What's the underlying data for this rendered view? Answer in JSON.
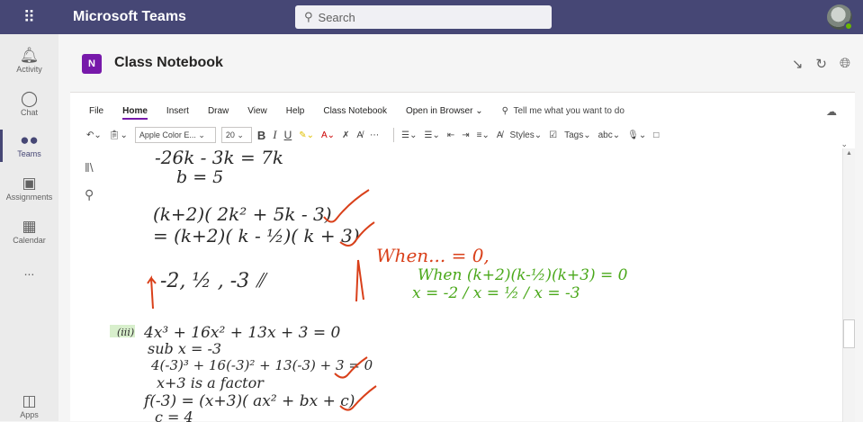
{
  "topbar": {
    "waffle_icon": "app-launcher-icon",
    "app_name": "Microsoft Teams",
    "search_placeholder": "Search",
    "search_icon": "search-icon"
  },
  "rail": {
    "items": [
      {
        "label": "Activity",
        "icon": "bell-icon"
      },
      {
        "label": "Chat",
        "icon": "chat-icon"
      },
      {
        "label": "Teams",
        "icon": "teams-icon",
        "active": true
      },
      {
        "label": "Assignments",
        "icon": "assignments-icon"
      },
      {
        "label": "Calendar",
        "icon": "calendar-icon"
      },
      {
        "label": "...",
        "icon": "more-icon"
      },
      {
        "label": "Apps",
        "icon": "apps-icon"
      }
    ]
  },
  "header": {
    "logo_text": "N",
    "title": "Class Notebook"
  },
  "menu": {
    "items": [
      "File",
      "Home",
      "Insert",
      "Draw",
      "View",
      "Help",
      "Class Notebook",
      "Open in Browser ⌄"
    ],
    "active": "Home",
    "tell_me": "Tell me what you want to do"
  },
  "ribbon": {
    "font_name": "Apple Color E...",
    "font_size": "20",
    "bold": "B",
    "italic": "I",
    "underline": "U",
    "styles": "Styles",
    "tags": "Tags"
  },
  "ink": {
    "line1": "-26k - 3k = 7k",
    "line2": "b = 5",
    "line3": "(k+2)( 2k² + 5k - 3)",
    "line4": "= (k+2)( k - ½)( k + 3)",
    "line5": "-2,  ½ ,  -3 ⫽",
    "when_red": "When... = 0,",
    "when_green": "When (k+2)(k-½)(k+3) = 0",
    "green2": "x = -2 / x = ½ / x = -3",
    "label_iii": "(iii)",
    "line6": "4x³ + 16x² + 13x + 3 = 0",
    "line7": "sub x = -3",
    "line8": "4(-3)³ + 16(-3)² + 13(-3) + 3 = 0",
    "line9": "x+3 is a factor",
    "line10": "f(-3) = (x+3)( ax² + bx + c)",
    "line11": "c = 4",
    "ink_red": "#d9401a",
    "ink_green": "#4aa81a",
    "ink_black": "#2a2a2a"
  }
}
